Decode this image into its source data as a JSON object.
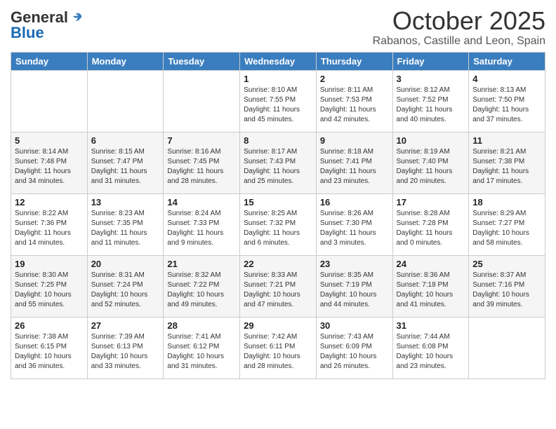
{
  "logo": {
    "general": "General",
    "blue": "Blue"
  },
  "header": {
    "month": "October 2025",
    "location": "Rabanos, Castille and Leon, Spain"
  },
  "weekdays": [
    "Sunday",
    "Monday",
    "Tuesday",
    "Wednesday",
    "Thursday",
    "Friday",
    "Saturday"
  ],
  "weeks": [
    [
      {
        "day": "",
        "info": ""
      },
      {
        "day": "",
        "info": ""
      },
      {
        "day": "",
        "info": ""
      },
      {
        "day": "1",
        "info": "Sunrise: 8:10 AM\nSunset: 7:55 PM\nDaylight: 11 hours and 45 minutes."
      },
      {
        "day": "2",
        "info": "Sunrise: 8:11 AM\nSunset: 7:53 PM\nDaylight: 11 hours and 42 minutes."
      },
      {
        "day": "3",
        "info": "Sunrise: 8:12 AM\nSunset: 7:52 PM\nDaylight: 11 hours and 40 minutes."
      },
      {
        "day": "4",
        "info": "Sunrise: 8:13 AM\nSunset: 7:50 PM\nDaylight: 11 hours and 37 minutes."
      }
    ],
    [
      {
        "day": "5",
        "info": "Sunrise: 8:14 AM\nSunset: 7:48 PM\nDaylight: 11 hours and 34 minutes."
      },
      {
        "day": "6",
        "info": "Sunrise: 8:15 AM\nSunset: 7:47 PM\nDaylight: 11 hours and 31 minutes."
      },
      {
        "day": "7",
        "info": "Sunrise: 8:16 AM\nSunset: 7:45 PM\nDaylight: 11 hours and 28 minutes."
      },
      {
        "day": "8",
        "info": "Sunrise: 8:17 AM\nSunset: 7:43 PM\nDaylight: 11 hours and 25 minutes."
      },
      {
        "day": "9",
        "info": "Sunrise: 8:18 AM\nSunset: 7:41 PM\nDaylight: 11 hours and 23 minutes."
      },
      {
        "day": "10",
        "info": "Sunrise: 8:19 AM\nSunset: 7:40 PM\nDaylight: 11 hours and 20 minutes."
      },
      {
        "day": "11",
        "info": "Sunrise: 8:21 AM\nSunset: 7:38 PM\nDaylight: 11 hours and 17 minutes."
      }
    ],
    [
      {
        "day": "12",
        "info": "Sunrise: 8:22 AM\nSunset: 7:36 PM\nDaylight: 11 hours and 14 minutes."
      },
      {
        "day": "13",
        "info": "Sunrise: 8:23 AM\nSunset: 7:35 PM\nDaylight: 11 hours and 11 minutes."
      },
      {
        "day": "14",
        "info": "Sunrise: 8:24 AM\nSunset: 7:33 PM\nDaylight: 11 hours and 9 minutes."
      },
      {
        "day": "15",
        "info": "Sunrise: 8:25 AM\nSunset: 7:32 PM\nDaylight: 11 hours and 6 minutes."
      },
      {
        "day": "16",
        "info": "Sunrise: 8:26 AM\nSunset: 7:30 PM\nDaylight: 11 hours and 3 minutes."
      },
      {
        "day": "17",
        "info": "Sunrise: 8:28 AM\nSunset: 7:28 PM\nDaylight: 11 hours and 0 minutes."
      },
      {
        "day": "18",
        "info": "Sunrise: 8:29 AM\nSunset: 7:27 PM\nDaylight: 10 hours and 58 minutes."
      }
    ],
    [
      {
        "day": "19",
        "info": "Sunrise: 8:30 AM\nSunset: 7:25 PM\nDaylight: 10 hours and 55 minutes."
      },
      {
        "day": "20",
        "info": "Sunrise: 8:31 AM\nSunset: 7:24 PM\nDaylight: 10 hours and 52 minutes."
      },
      {
        "day": "21",
        "info": "Sunrise: 8:32 AM\nSunset: 7:22 PM\nDaylight: 10 hours and 49 minutes."
      },
      {
        "day": "22",
        "info": "Sunrise: 8:33 AM\nSunset: 7:21 PM\nDaylight: 10 hours and 47 minutes."
      },
      {
        "day": "23",
        "info": "Sunrise: 8:35 AM\nSunset: 7:19 PM\nDaylight: 10 hours and 44 minutes."
      },
      {
        "day": "24",
        "info": "Sunrise: 8:36 AM\nSunset: 7:18 PM\nDaylight: 10 hours and 41 minutes."
      },
      {
        "day": "25",
        "info": "Sunrise: 8:37 AM\nSunset: 7:16 PM\nDaylight: 10 hours and 39 minutes."
      }
    ],
    [
      {
        "day": "26",
        "info": "Sunrise: 7:38 AM\nSunset: 6:15 PM\nDaylight: 10 hours and 36 minutes."
      },
      {
        "day": "27",
        "info": "Sunrise: 7:39 AM\nSunset: 6:13 PM\nDaylight: 10 hours and 33 minutes."
      },
      {
        "day": "28",
        "info": "Sunrise: 7:41 AM\nSunset: 6:12 PM\nDaylight: 10 hours and 31 minutes."
      },
      {
        "day": "29",
        "info": "Sunrise: 7:42 AM\nSunset: 6:11 PM\nDaylight: 10 hours and 28 minutes."
      },
      {
        "day": "30",
        "info": "Sunrise: 7:43 AM\nSunset: 6:09 PM\nDaylight: 10 hours and 26 minutes."
      },
      {
        "day": "31",
        "info": "Sunrise: 7:44 AM\nSunset: 6:08 PM\nDaylight: 10 hours and 23 minutes."
      },
      {
        "day": "",
        "info": ""
      }
    ]
  ]
}
